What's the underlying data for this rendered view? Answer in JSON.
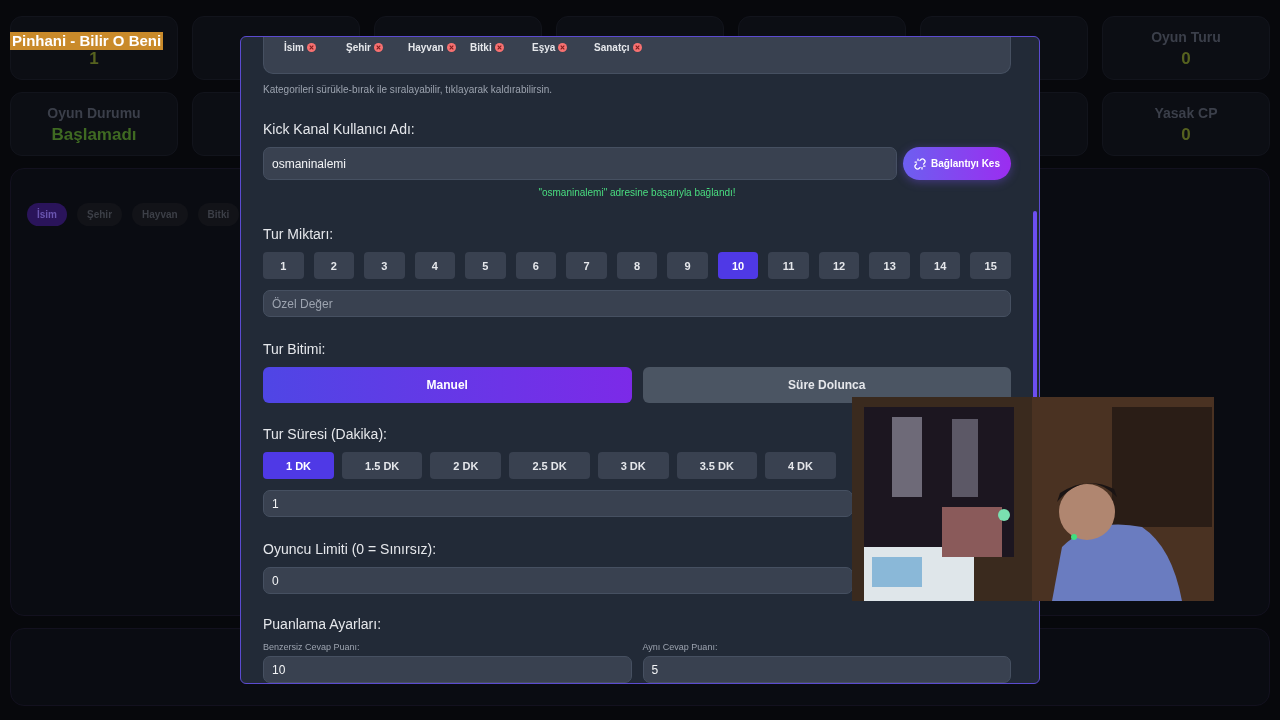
{
  "now_playing": "Pinhani - Bilir O Beni",
  "stat_rows": [
    {
      "left": {
        "value": "1",
        "kind": "number"
      },
      "right": {
        "label": "Oyun Turu",
        "value": "0",
        "kind": "number"
      }
    },
    {
      "left": {
        "label": "Oyun Durumu",
        "value": "Başlamadı",
        "kind": "status"
      },
      "right": {
        "label": "Yasak CP",
        "value": "0",
        "kind": "number"
      }
    }
  ],
  "category_tabs": [
    {
      "label": "İsim",
      "selected": true
    },
    {
      "label": "Şehir",
      "selected": false
    },
    {
      "label": "Hayvan",
      "selected": false
    },
    {
      "label": "Bitki",
      "selected": false
    }
  ],
  "settings": {
    "categories": [
      {
        "label": "İsim"
      },
      {
        "label": "Şehir"
      },
      {
        "label": "Hayvan"
      },
      {
        "label": "Bitki"
      },
      {
        "label": "Eşya"
      },
      {
        "label": "Sanatçı"
      }
    ],
    "categories_hint": "Kategorileri sürükle-bırak ile sıralayabilir, tıklayarak kaldırabilirsin.",
    "kick_label": "Kick Kanal Kullanıcı Adı:",
    "kick_value": "osmaninalemi",
    "disconnect_button": "Bağlantıyı Kes",
    "connection_message": "\"osmaninalemi\" adresine başarıyla bağlandı!",
    "round_count": {
      "label": "Tur Miktarı:",
      "custom_placeholder": "Özel Değer",
      "options": [
        {
          "label": "1",
          "selected": false
        },
        {
          "label": "2",
          "selected": false
        },
        {
          "label": "3",
          "selected": false
        },
        {
          "label": "4",
          "selected": false
        },
        {
          "label": "5",
          "selected": false
        },
        {
          "label": "6",
          "selected": false
        },
        {
          "label": "7",
          "selected": false
        },
        {
          "label": "8",
          "selected": false
        },
        {
          "label": "9",
          "selected": false
        },
        {
          "label": "10",
          "selected": true
        },
        {
          "label": "11",
          "selected": false
        },
        {
          "label": "12",
          "selected": false
        },
        {
          "label": "13",
          "selected": false
        },
        {
          "label": "14",
          "selected": false
        },
        {
          "label": "15",
          "selected": false
        }
      ]
    },
    "round_end": {
      "label": "Tur Bitimi:",
      "options": [
        {
          "label": "Manuel",
          "selected": true
        },
        {
          "label": "Süre Dolunca",
          "selected": false
        }
      ]
    },
    "round_duration": {
      "label": "Tur Süresi (Dakika):",
      "value": "1",
      "options": [
        {
          "label": "1 DK",
          "selected": true
        },
        {
          "label": "1.5 DK",
          "selected": false
        },
        {
          "label": "2 DK",
          "selected": false
        },
        {
          "label": "2.5 DK",
          "selected": false
        },
        {
          "label": "3 DK",
          "selected": false
        },
        {
          "label": "3.5 DK",
          "selected": false
        },
        {
          "label": "4 DK",
          "selected": false
        }
      ]
    },
    "player_limit": {
      "label": "Oyuncu Limiti (0 = Sınırsız):",
      "value": "0"
    },
    "scoring": {
      "label": "Puanlama Ayarları:",
      "fields": [
        {
          "label": "Benzersiz Cevap Puanı:",
          "value": "10"
        },
        {
          "label": "Aynı Cevap Puanı:",
          "value": "5"
        }
      ]
    }
  }
}
